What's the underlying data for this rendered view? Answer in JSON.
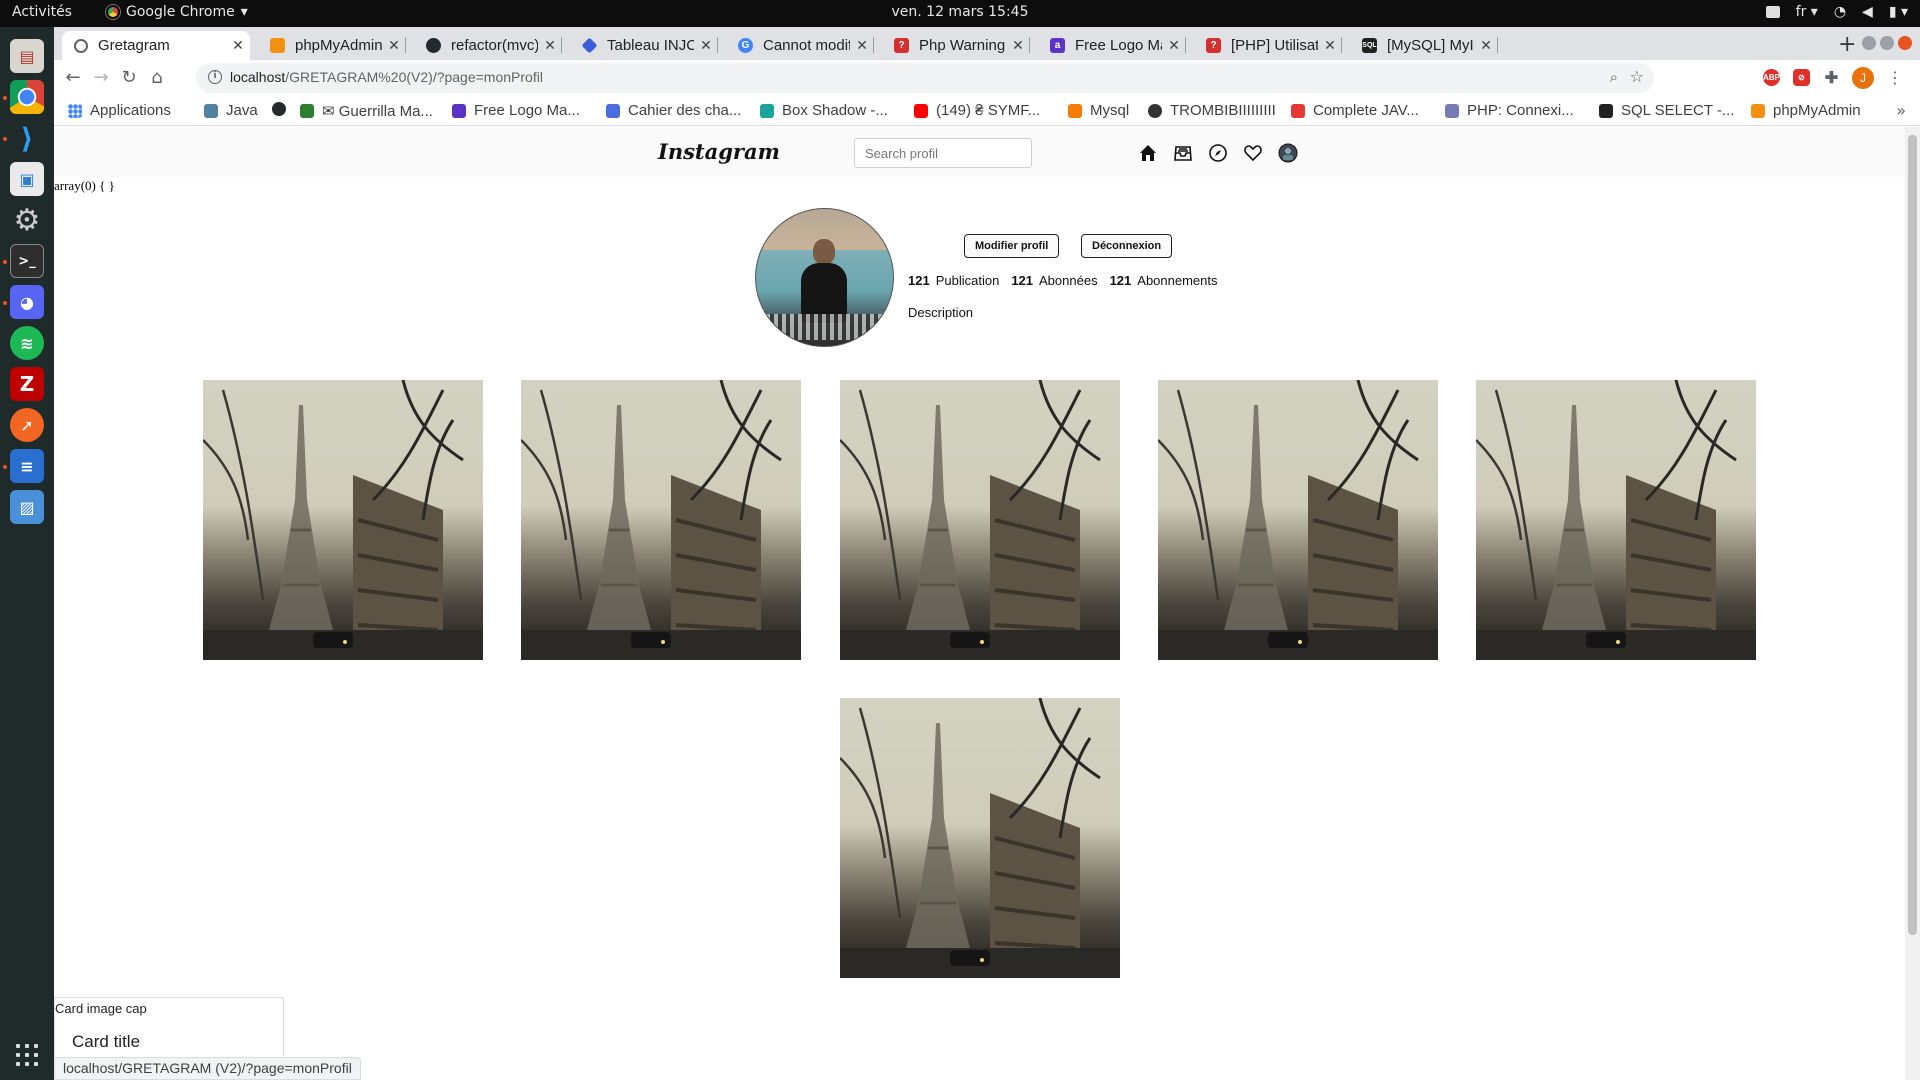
{
  "system": {
    "activities": "Activités",
    "app_name": "Google Chrome",
    "clock": "ven. 12 mars  15:45",
    "lang": "fr"
  },
  "browser": {
    "tabs": [
      {
        "label": "Gretagram",
        "active": true,
        "color": "#5f6368"
      },
      {
        "label": "phpMyAdmin",
        "active": false,
        "color": "#f29111"
      },
      {
        "label": "refactor(mvc): new",
        "active": false,
        "color": "#24292e"
      },
      {
        "label": "Tableau INJC – Feu",
        "active": false,
        "color": "#3b5bdb"
      },
      {
        "label": "Cannot modify hea",
        "active": false,
        "color": "#4285f4"
      },
      {
        "label": "Php Warning: Can",
        "active": false,
        "color": "#d32f2f"
      },
      {
        "label": "Free Logo Maker -",
        "active": false,
        "color": "#5b34c7"
      },
      {
        "label": "[PHP] Utilisation d",
        "active": false,
        "color": "#d32f2f"
      },
      {
        "label": "[MySQL] MyISAM v",
        "active": false,
        "color": "#222222"
      }
    ],
    "url_host": "localhost",
    "url_rest": "/GRETAGRAM%20(V2)/?page=monProfil",
    "bookmarks": [
      {
        "label": "Applications",
        "color": "#4285f4"
      },
      {
        "label": "Java",
        "color": "#5382a1"
      },
      {
        "label": "",
        "color": "#24292e"
      },
      {
        "label": "✉ Guerrilla Ma...",
        "color": "#2e7d32"
      },
      {
        "label": "Free Logo Ma...",
        "color": "#5b34c7"
      },
      {
        "label": "Cahier des cha...",
        "color": "#4a6ee0"
      },
      {
        "label": "Box Shadow -...",
        "color": "#1aa39a"
      },
      {
        "label": "(149) ₴ SYMF...",
        "color": "#ff0000"
      },
      {
        "label": "Mysql",
        "color": "#f57c00"
      },
      {
        "label": "TROMBIBIIIIIIIII",
        "color": "#333333"
      },
      {
        "label": "Complete JAV...",
        "color": "#e53935"
      },
      {
        "label": "PHP: Connexi...",
        "color": "#777bb3"
      },
      {
        "label": "SQL SELECT -...",
        "color": "#222222"
      },
      {
        "label": "phpMyAdmin",
        "color": "#f29111"
      }
    ],
    "status_url": "localhost/GRETAGRAM (V2)/?page=monProfil"
  },
  "page": {
    "logo": "Instagram",
    "search_placeholder": "Search profil",
    "debug_output": "array(0) { }",
    "buttons": {
      "edit_profile": "Modifier profil",
      "logout": "Déconnexion"
    },
    "stats": [
      {
        "count": "121",
        "label": "Publication"
      },
      {
        "count": "121",
        "label": "Abonnées"
      },
      {
        "count": "121",
        "label": "Abonnements"
      }
    ],
    "description": "Description",
    "card": {
      "image_alt": "Card image cap",
      "title": "Card title"
    }
  }
}
